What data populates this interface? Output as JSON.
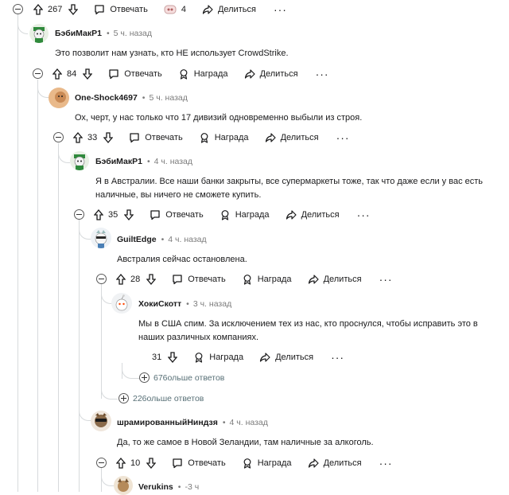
{
  "top_bar": {
    "score": "267",
    "reply": "Отвечать",
    "award_count": "4",
    "share": "Делиться",
    "more": "···"
  },
  "comments": [
    {
      "user": "БэбиМакР1",
      "time": "5 ч. назад",
      "text": "Это позволит нам узнать, кто НЕ использует CrowdStrike.",
      "score": "84",
      "reply": "Отвечать",
      "award": "Награда",
      "share": "Делиться",
      "more": "···"
    },
    {
      "user": "One-Shock4697",
      "time": "5 ч. назад",
      "text": "Ох, черт, у нас только что 17 дивизий одновременно выбыли из строя.",
      "score": "33",
      "reply": "Отвечать",
      "award": "Награда",
      "share": "Делиться",
      "more": "···"
    },
    {
      "user": "БэбиМакР1",
      "time": "4 ч. назад",
      "text_line1": "Я в Австралии. Все наши банки закрыты, все супермаркеты тоже, так что даже если у вас есть",
      "text_line2": "наличные, вы ничего не сможете купить.",
      "score": "35",
      "reply": "Отвечать",
      "award": "Награда",
      "share": "Делиться",
      "more": "···"
    },
    {
      "user": "GuiltEdge",
      "time": "4 ч. назад",
      "text": "Австралия сейчас остановлена.",
      "score": "28",
      "reply": "Отвечать",
      "award": "Награда",
      "share": "Делиться",
      "more": "···"
    },
    {
      "user": "ХокиСкотт",
      "time": "3 ч. назад",
      "text_line1": "Мы в США спим. За исключением тех из нас, кто проснулся, чтобы исправить это в",
      "text_line2": "наших различных компаниях.",
      "score": "31",
      "award": "Награда",
      "share": "Делиться",
      "more": "···"
    },
    {
      "user": "шрамированныйНиндзя",
      "time": "4 ч. назад",
      "text": "Да, то же самое в Новой Зеландии, там наличные за алкоголь.",
      "score": "10",
      "reply": "Отвечать",
      "award": "Награда",
      "share": "Делиться",
      "more": "···"
    },
    {
      "user": "Verukins",
      "time": "-3 ч"
    }
  ],
  "more_replies": [
    "676ольше ответов",
    "226ольше ответов"
  ],
  "colors": {
    "line": "#d7dadc",
    "text": "#1a1a1b",
    "muted": "#7c7c7c"
  }
}
